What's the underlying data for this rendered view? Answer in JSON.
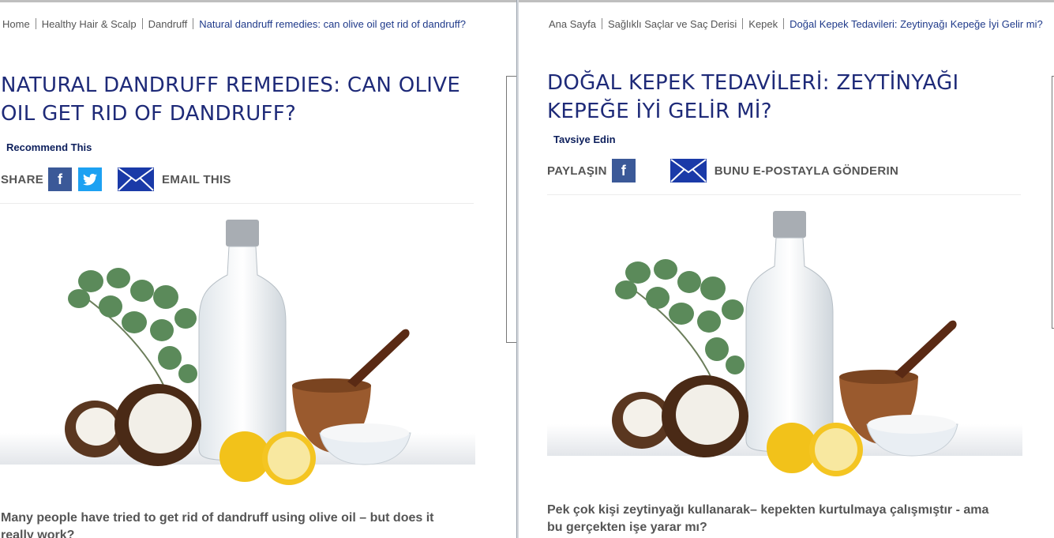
{
  "left": {
    "breadcrumb": [
      "Home",
      "Healthy Hair & Scalp",
      "Dandruff"
    ],
    "breadcrumb_current": "Natural dandruff remedies: can olive oil get rid of dandruff?",
    "title_line1": "NATURAL DANDRUFF REMEDIES: CAN OLIVE",
    "title_line2": "OIL GET RID OF DANDRUFF?",
    "recommend": "Recommend This",
    "share_label": "SHARE",
    "email_label": "EMAIL THIS",
    "lead_line1": "Many people have tried to get rid of dandruff using olive oil – but does it",
    "lead_line2": "really work?"
  },
  "right": {
    "breadcrumb": [
      "Ana Sayfa",
      "Sağlıklı Saçlar ve Saç Derisi",
      "Kepek"
    ],
    "breadcrumb_current": "Doğal Kepek Tedavileri: Zeytinyağı Kepeğe İyi Gelir mi?",
    "title_line1": "DOĞAL KEPEK TEDAVİLERİ: ZEYTİNYAĞI",
    "title_line2": "KEPEĞE İYİ GELİR Mİ?",
    "recommend": "Tavsiye Edin",
    "share_label": "PAYLAŞIN",
    "email_label": "BUNU E-POSTAYLA GÖNDERIN",
    "lead_line1": "Pek çok kişi zeytinyağı kullanarak– kepekten kurtulmaya çalışmıştır - ama",
    "lead_line2": "bu gerçekten işe yarar mı?"
  },
  "icons": {
    "facebook": "facebook-icon",
    "twitter": "twitter-icon",
    "email": "envelope-icon"
  },
  "colors": {
    "title": "#1e2a78",
    "link_current": "#1f3a8a",
    "facebook": "#3b5998",
    "twitter": "#1da1f2",
    "envelope": "#1a3aa8"
  }
}
